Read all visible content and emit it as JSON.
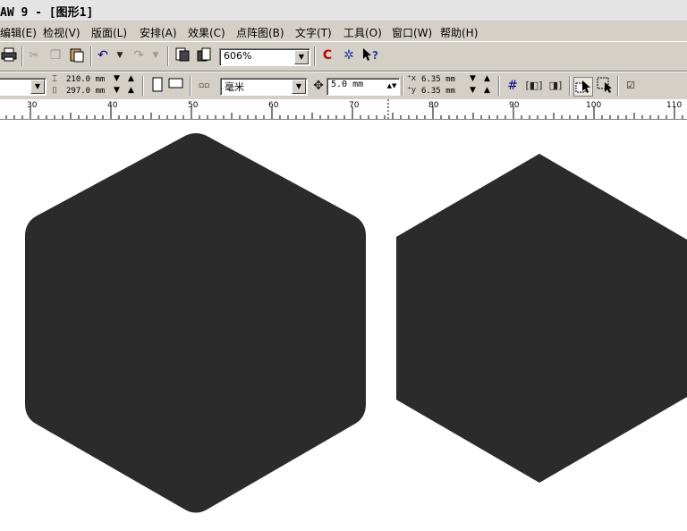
{
  "window": {
    "title": "AW 9 - [图形1]"
  },
  "menu": {
    "items": [
      "编辑(E)",
      "检视(V)",
      "版面(L)",
      "安排(A)",
      "效果(C)",
      "点阵图(B)",
      "文字(T)",
      "工具(O)",
      "窗口(W)",
      "帮助(H)"
    ]
  },
  "toolbar": {
    "zoom_value": "606%"
  },
  "property_bar": {
    "page_width": "210.0 mm",
    "page_height": "297.0 mm",
    "units": "毫米",
    "nudge": "5.0 mm",
    "dup_x": "6.35 mm",
    "dup_y": "6.35 mm"
  },
  "ruler": {
    "labels": [
      "30",
      "40",
      "50",
      "60",
      "70",
      "80",
      "90",
      "100",
      "110"
    ]
  },
  "colors": {
    "shape_fill": "#2b2b2b",
    "ui_face": "#d4d0c8"
  }
}
